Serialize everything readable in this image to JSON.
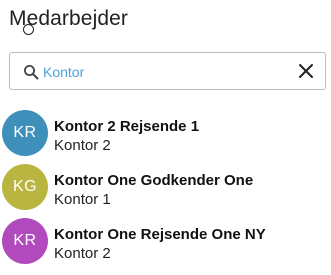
{
  "header": {
    "title": "Medarbejder"
  },
  "search": {
    "value": "Kontor",
    "placeholder": "",
    "search_icon": "search-icon",
    "clear_icon": "close-icon"
  },
  "employees": [
    {
      "initials": "KR",
      "name": "Kontor 2 Rejsende 1",
      "office": "Kontor 2",
      "color": "#3e8fba"
    },
    {
      "initials": "KG",
      "name": "Kontor One Godkender One",
      "office": "Kontor 1",
      "color": "#b9b540"
    },
    {
      "initials": "KR",
      "name": "Kontor One Rejsende One NY",
      "office": "Kontor 2",
      "color": "#b14bbd"
    }
  ]
}
